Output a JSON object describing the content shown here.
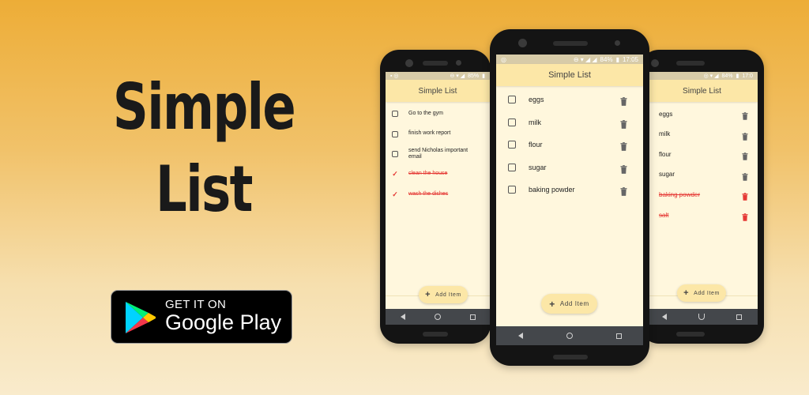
{
  "hero": {
    "line1": "Simple",
    "line2": "List"
  },
  "badge": {
    "top": "GET IT ON",
    "main": "Google Play",
    "icon": "google-play-icon"
  },
  "app": {
    "title": "Simple List",
    "add_label": "Add Item"
  },
  "phone_left": {
    "battery": "85%",
    "items": [
      {
        "label": "Go to the gym",
        "done": false
      },
      {
        "label": "finish work report",
        "done": false
      },
      {
        "label": "send Nicholas important email",
        "done": false
      },
      {
        "label": "clean the house",
        "done": true
      },
      {
        "label": "wash the dishes",
        "done": true
      }
    ]
  },
  "phone_center": {
    "battery": "84%",
    "time": "17:05",
    "items": [
      {
        "label": "eggs",
        "done": false
      },
      {
        "label": "milk",
        "done": false
      },
      {
        "label": "flour",
        "done": false
      },
      {
        "label": "sugar",
        "done": false
      },
      {
        "label": "baking powder",
        "done": false
      }
    ]
  },
  "phone_right": {
    "battery": "84%",
    "time": "17:0",
    "items": [
      {
        "label": "eggs",
        "done": false
      },
      {
        "label": "milk",
        "done": false
      },
      {
        "label": "flour",
        "done": false
      },
      {
        "label": "sugar",
        "done": false
      },
      {
        "label": "baking powder",
        "done": true
      },
      {
        "label": "salt",
        "done": true
      }
    ]
  },
  "colors": {
    "accent_done": "#E53935",
    "app_bar": "#FCE7A7",
    "screen_bg": "#FFF7DD"
  }
}
